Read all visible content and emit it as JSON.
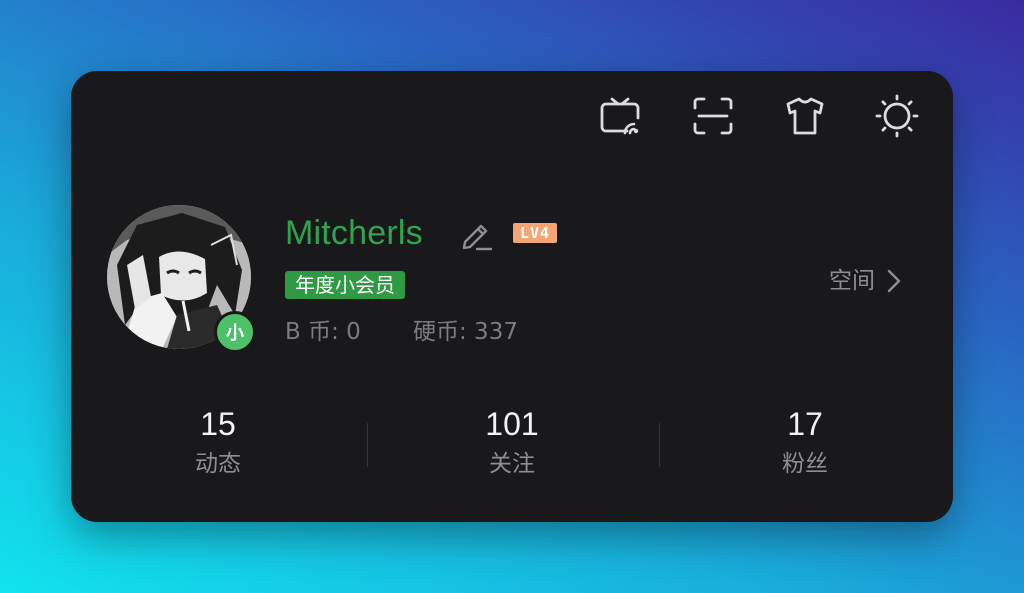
{
  "toolbar": {
    "icons": [
      "tv-cast-icon",
      "scan-icon",
      "tshirt-icon",
      "sun-icon"
    ]
  },
  "profile": {
    "username": "Mitcherls",
    "level": "LV4",
    "vip_tag": "年度小会员",
    "avatar_badge": "小",
    "b_coin_label": "B 币: 0",
    "coin_label": "硬币: 337",
    "space_label": "空间"
  },
  "stats": [
    {
      "value": "15",
      "label": "动态"
    },
    {
      "value": "101",
      "label": "关注"
    },
    {
      "value": "17",
      "label": "粉丝"
    }
  ],
  "colors": {
    "card_bg": "#19191b",
    "username": "#2ea44f",
    "vip_tag_bg": "#2f9a43",
    "level_badge": "#f5a575",
    "avatar_badge": "#4cc167",
    "muted_text": "#8d8d92",
    "stat_value": "#f4f4f6"
  }
}
